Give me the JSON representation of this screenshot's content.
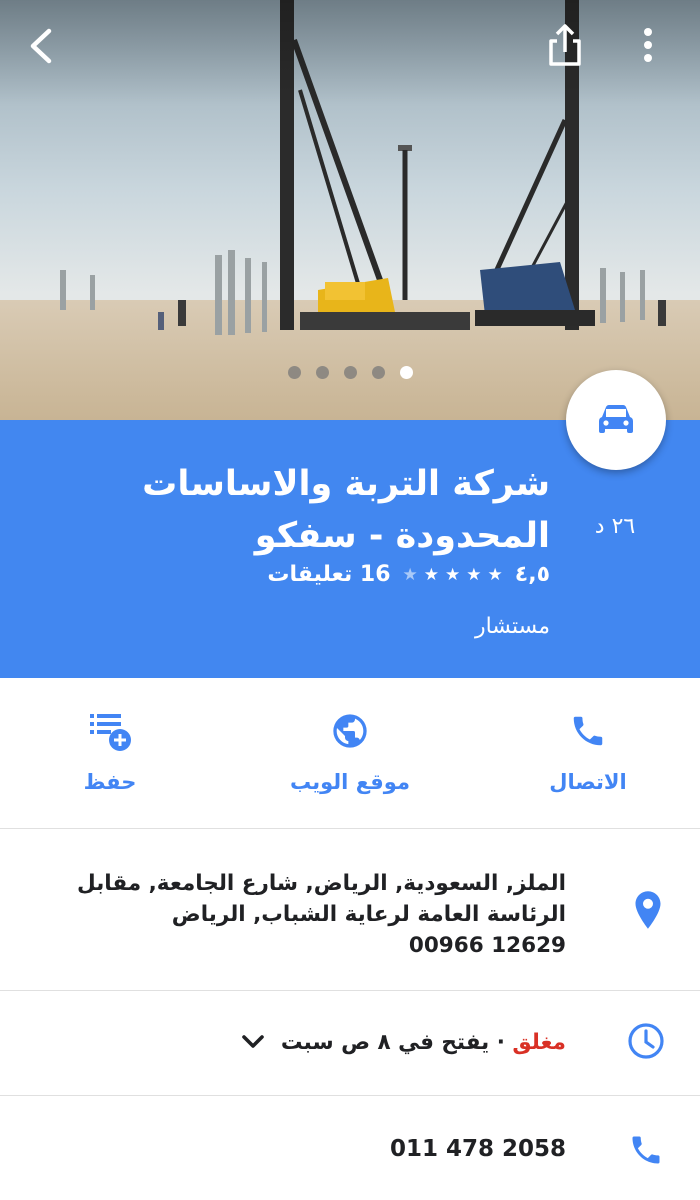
{
  "header": {
    "back_icon": "arrow-back-icon",
    "share_icon": "share-icon",
    "menu_icon": "more-vert-icon",
    "photo_count": 5,
    "active_photo": 5
  },
  "place": {
    "name": "شركة التربة والاساسات المحدودة - سفكو",
    "rating": "٤,٥",
    "reviews": "16 تعليقات",
    "category": "مستشار",
    "drive_time": "٢٦ د",
    "stars": 4.5
  },
  "actions": [
    {
      "label": "الاتصال",
      "icon": "phone-icon"
    },
    {
      "label": "موقع الويب",
      "icon": "globe-icon"
    },
    {
      "label": "حفظ",
      "icon": "save-list-icon"
    }
  ],
  "address": {
    "lines": [
      "الملز, السعودية, الرياض, شارع الجامعة, مقابل",
      "الرئاسة العامة لرعاية الشباب, الرياض",
      "12629 00966"
    ]
  },
  "hours": {
    "status": "مغلق",
    "separator": " · ",
    "detail": "يفتح في ٨ ص سبت"
  },
  "phone": {
    "number": "011 478 2058"
  },
  "colors": {
    "brand_blue": "#4287f0",
    "accent_blue": "#4285f4",
    "closed_red": "#d93025"
  }
}
